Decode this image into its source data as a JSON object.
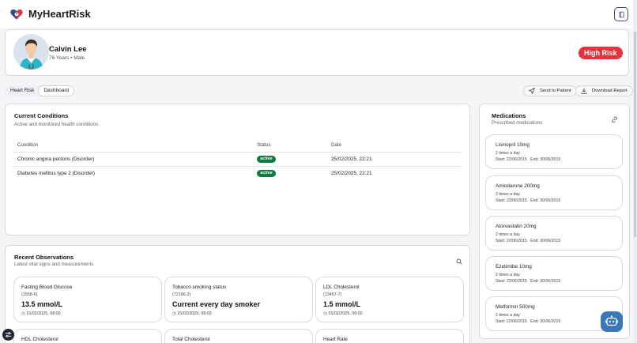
{
  "app": {
    "title": "MyHeartRisk"
  },
  "header": {
    "icon": "book-icon"
  },
  "patient": {
    "name": "Calvin Lee",
    "meta": "76 Years • Male",
    "risk_badge": "High Risk"
  },
  "tabs": [
    {
      "label": "Heart Risk"
    },
    {
      "label": "Dashboard"
    }
  ],
  "actions": {
    "send": "Send to Patient",
    "download": "Download Report"
  },
  "conditions": {
    "title": "Current Conditions",
    "subtitle": "Active and monitored health conditions",
    "columns": [
      "Condition",
      "Status",
      "Date"
    ],
    "rows": [
      {
        "condition": "Chronic angina pectoris (Disorder)",
        "status": "active",
        "date": "25/02/2025, 22:21"
      },
      {
        "condition": "Diabetes mellitus type 2 (Disorder)",
        "status": "active",
        "date": "25/02/2025, 22:21"
      }
    ]
  },
  "observations": {
    "title": "Recent Observations",
    "subtitle": "Latest vital signs and measurements",
    "items": [
      {
        "name": "Fasting Blood Glucose",
        "code": "(1558-6)",
        "value": "13.5 mmol/L",
        "date": "15/02/2025, 08:00"
      },
      {
        "name": "Tobacco smoking status",
        "code": "(72166-2)",
        "value": "Current every day smoker",
        "date": "15/02/2025, 08:00"
      },
      {
        "name": "LDL Cholesterol",
        "code": "(13457-7)",
        "value": "1.5 mmol/L",
        "date": "15/02/2025, 08:00"
      },
      {
        "name": "HDL Cholesterol"
      },
      {
        "name": "Total Cholesterol"
      },
      {
        "name": "Heart Rate"
      }
    ]
  },
  "medications": {
    "title": "Medications",
    "subtitle": "Prescribed medications",
    "items": [
      {
        "name": "Lisinopril 10mg",
        "frequency": "2 times a day",
        "start": "Start: 22/06/2015",
        "end": "End: 30/06/2015"
      },
      {
        "name": "Amiodarone 200mg",
        "frequency": "2 times a day",
        "start": "Start: 22/06/2015",
        "end": "End: 30/06/2015"
      },
      {
        "name": "Atorvastatin 20mg",
        "frequency": "2 times a day",
        "start": "Start: 22/06/2015",
        "end": "End: 30/06/2015"
      },
      {
        "name": "Ezetimibe 10mg",
        "frequency": "2 times a day",
        "start": "Start: 22/06/2015",
        "end": "End: 30/06/2015"
      },
      {
        "name": "Metformin 500mg",
        "frequency": "2 times a day",
        "start": "Start: 22/06/2015",
        "end": "End: 30/06/2015"
      }
    ]
  },
  "colors": {
    "risk": "#e5323b",
    "active": "#0e7a3d",
    "assistant": "#3a78b8"
  }
}
